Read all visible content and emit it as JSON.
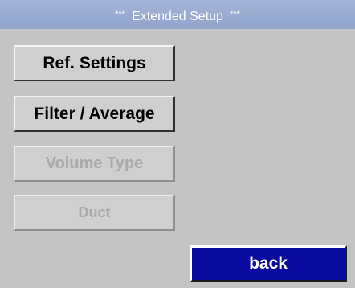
{
  "header": {
    "title": "Extended Setup",
    "stars_left": "***",
    "stars_right": "***"
  },
  "menu": {
    "items": [
      {
        "label": "Ref. Settings",
        "enabled": true
      },
      {
        "label": "Filter / Average",
        "enabled": true
      },
      {
        "label": "Volume Type",
        "enabled": false
      },
      {
        "label": "Duct",
        "enabled": false
      }
    ]
  },
  "footer": {
    "back_label": "back"
  },
  "colors": {
    "background": "#c4c4c4",
    "title_bar": "#98a9d0",
    "back_button": "#0a0a9e",
    "disabled_text": "#a9a9a9"
  }
}
